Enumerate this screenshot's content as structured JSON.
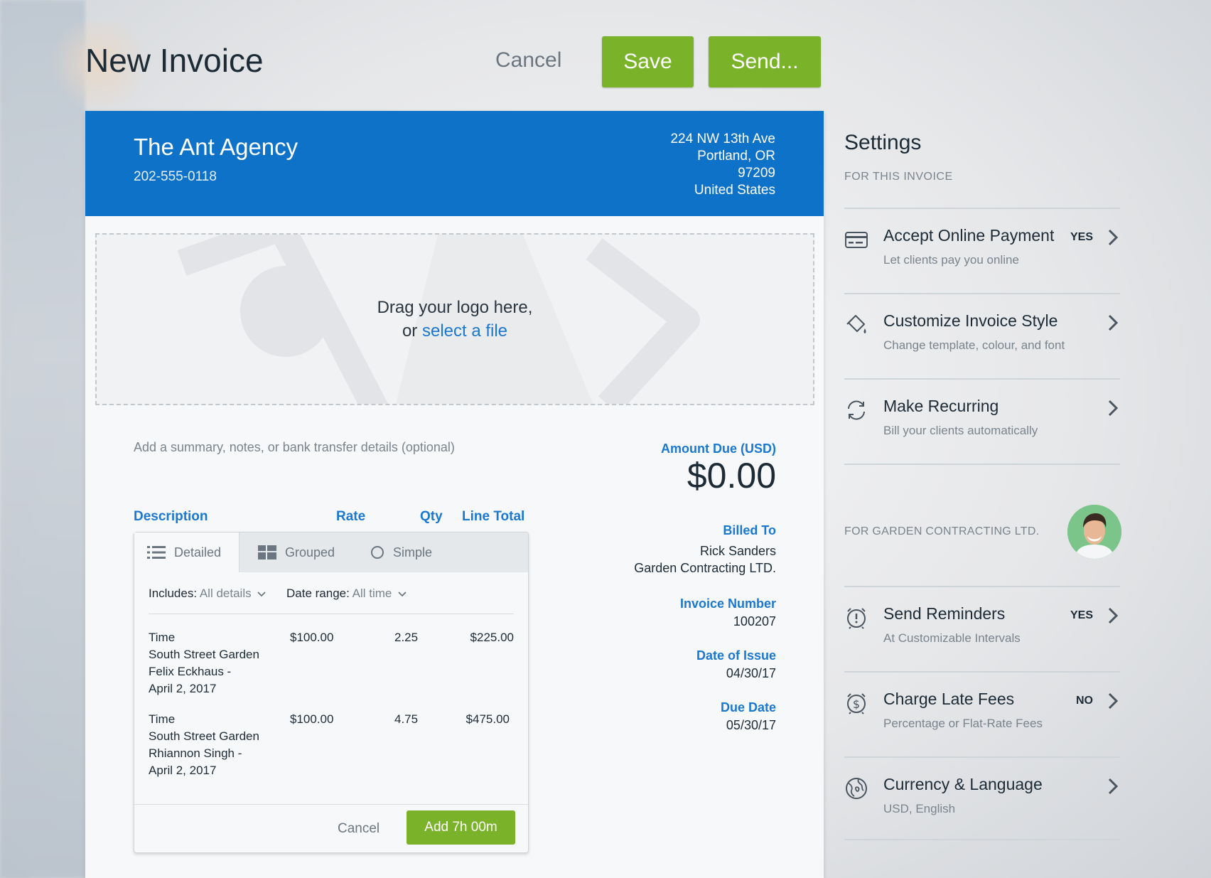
{
  "page": {
    "title": "New Invoice",
    "cancel_label": "Cancel",
    "save_label": "Save",
    "send_label": "Send..."
  },
  "company": {
    "name": "The Ant Agency",
    "phone": "202-555-0118",
    "address_line1": "224 NW 13th Ave",
    "address_line2": "Portland, OR",
    "address_line3": "97209",
    "address_line4": "United States"
  },
  "logo_dropzone": {
    "line1": "Drag your logo here,",
    "line2_prefix": "or ",
    "line2_link": "select a file"
  },
  "notes_placeholder": "Add a summary, notes, or bank transfer details (optional)",
  "amount_due": {
    "label": "Amount Due (USD)",
    "value": "$0.00"
  },
  "columns": {
    "description": "Description",
    "rate": "Rate",
    "qty": "Qty",
    "line_total": "Line Total"
  },
  "time_panel": {
    "tabs": [
      {
        "label": "Detailed",
        "icon": "list-icon"
      },
      {
        "label": "Grouped",
        "icon": "grid-icon"
      },
      {
        "label": "Simple",
        "icon": "circle-icon"
      }
    ],
    "includes_label": "Includes:",
    "includes_value": "All details",
    "date_range_label": "Date range:",
    "date_range_value": "All time",
    "rows": [
      {
        "type": "Time",
        "project": "South Street Garden",
        "person": "Felix Eckhaus -",
        "date": "April 2, 2017",
        "rate": "$100.00",
        "qty": "2.25",
        "total": "$225.00"
      },
      {
        "type": "Time",
        "project": "South Street Garden",
        "person": "Rhiannon Singh -",
        "date": "April 2, 2017",
        "rate": "$100.00",
        "qty": "4.75",
        "total": "$475.00"
      }
    ],
    "cancel_label": "Cancel",
    "add_label": "Add 7h 00m"
  },
  "billed_to": {
    "label": "Billed To",
    "name": "Rick Sanders",
    "company": "Garden Contracting LTD."
  },
  "invoice_number": {
    "label": "Invoice Number",
    "value": "100207"
  },
  "date_of_issue": {
    "label": "Date of Issue",
    "value": "04/30/17"
  },
  "due_date": {
    "label": "Due Date",
    "value": "05/30/17"
  },
  "settings": {
    "title": "Settings",
    "subtitle": "FOR THIS INVOICE",
    "client_label": "FOR GARDEN CONTRACTING LTD.",
    "items": [
      {
        "title": "Accept Online Payment",
        "desc": "Let clients pay you online",
        "badge": "YES",
        "icon": "credit-card-icon"
      },
      {
        "title": "Customize Invoice Style",
        "desc": "Change template, colour, and font",
        "badge": "",
        "icon": "paint-bucket-icon"
      },
      {
        "title": "Make Recurring",
        "desc": "Bill your clients automatically",
        "badge": "",
        "icon": "recurring-icon"
      },
      {
        "title": "Send Reminders",
        "desc": "At Customizable Intervals",
        "badge": "YES",
        "icon": "alarm-icon"
      },
      {
        "title": "Charge Late Fees",
        "desc": "Percentage or Flat-Rate Fees",
        "badge": "NO",
        "icon": "dollar-clock-icon"
      },
      {
        "title": "Currency & Language",
        "desc": "USD, English",
        "badge": "",
        "icon": "globe-icon"
      }
    ]
  },
  "colors": {
    "brand_blue": "#0f72c9",
    "link_blue": "#1a78d0",
    "action_green": "#7ab32a"
  }
}
